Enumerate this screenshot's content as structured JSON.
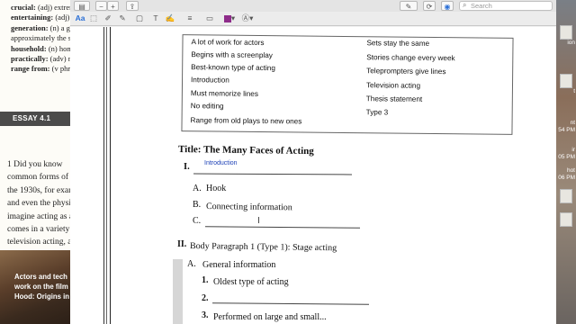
{
  "background_doc": {
    "vocab": [
      {
        "term": "crucial:",
        "def": "(adj) extrem"
      },
      {
        "term": "entertaining:",
        "def": "(adj) in"
      },
      {
        "term": "generation:",
        "def": "(n) a gr"
      },
      {
        "term": "",
        "def": "approximately the sa"
      },
      {
        "term": "household:",
        "def": "(n) hom"
      },
      {
        "term": "practically:",
        "def": "(adv) nea"
      },
      {
        "term": "range from:",
        "def": "(v phr) fro"
      }
    ],
    "essay_heading": "ESSAY 4.1",
    "essay_lines": [
      "1   Did you know",
      "common forms of",
      "the 1930s, for exam",
      "and even the physi",
      "imagine acting as a",
      "comes in a variety o",
      "television acting, an"
    ],
    "photo_caption": [
      "Actors and tech",
      "work on the film",
      "Hood: Origins in"
    ]
  },
  "desktop_right": {
    "labels": [
      "ion",
      "t",
      "nt",
      "54 PM",
      "ir",
      "05 PM",
      "hot",
      "06 PM"
    ]
  },
  "toolbar": {
    "search_placeholder": "Search",
    "zoom_out": "−",
    "zoom_in": "+",
    "share": "⇪",
    "markup_label": "Aa",
    "pen": "✎",
    "rotate": "⟳",
    "highlight": "◉"
  },
  "word_box": {
    "left": [
      "A lot of work for actors",
      "Begins with a screenplay",
      "Best-known type of acting",
      "Introduction",
      "Must memorize lines",
      "No editing",
      "Range from old plays to new ones"
    ],
    "right": [
      "Sets stay the same",
      "Stories change every week",
      "Teleprompters give lines",
      "Television acting",
      "Thesis statement",
      "Type 3"
    ]
  },
  "outline": {
    "title": "Title: The Many Faces of Acting",
    "section1_numeral": "I.",
    "section1_typed": "Introduction",
    "a_label": "A.",
    "a_text": "Hook",
    "b_label": "B.",
    "b_text": "Connecting information",
    "c_label": "C.",
    "section2_numeral": "II.",
    "section2_text": "Body Paragraph 1 (Type 1): Stage acting",
    "s2a_label": "A.",
    "s2a_text": "General information",
    "item1_num": "1.",
    "item1_text": "Oldest type of acting",
    "item2_num": "2.",
    "item3_num": "3.",
    "item3_text": "Performed on large and small..."
  }
}
